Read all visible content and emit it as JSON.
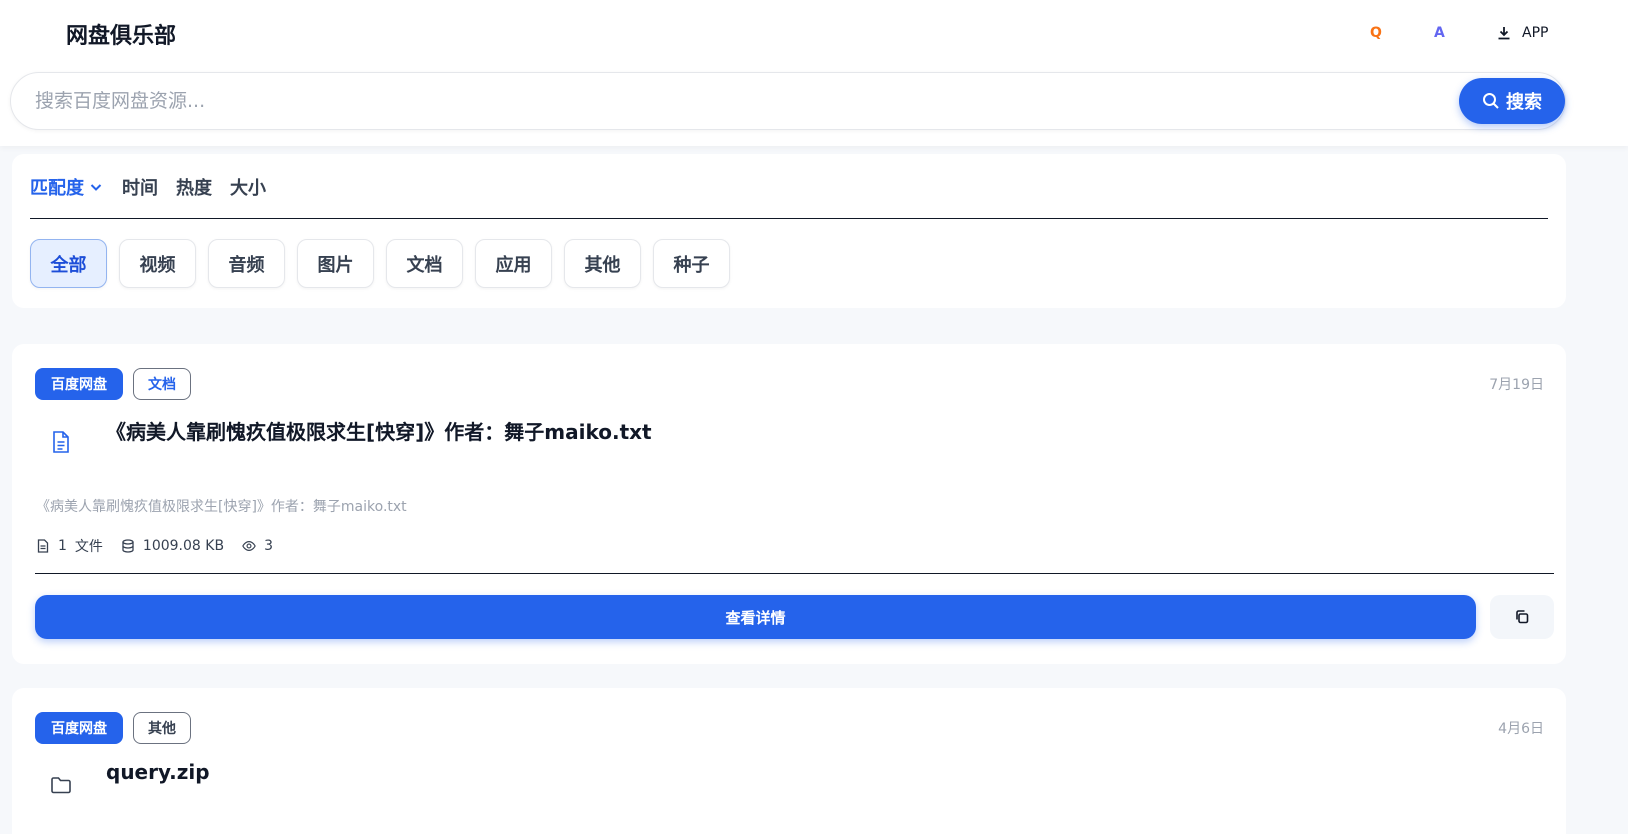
{
  "header": {
    "logo": "网盘俱乐部",
    "btn_q": "Q",
    "btn_a": "A",
    "btn_app": "APP"
  },
  "search": {
    "placeholder": "搜索百度网盘资源...",
    "button_label": "搜索"
  },
  "sort": {
    "items": [
      "匹配度",
      "时间",
      "热度",
      "大小"
    ],
    "active": "匹配度"
  },
  "categories": {
    "items": [
      "全部",
      "视频",
      "音频",
      "图片",
      "文档",
      "应用",
      "其他",
      "种子"
    ],
    "active": "全部"
  },
  "results": [
    {
      "source": "百度网盘",
      "type": "文档",
      "date": "7月19日",
      "icon": "document-icon",
      "title": "《病美人靠刷愧疚值极限求生[快穿]》作者：舞子maiko.txt",
      "description": "《病美人靠刷愧疚值极限求生[快穿]》作者：舞子maiko.txt",
      "file_count": "1",
      "file_unit": "文件",
      "size": "1009.08 KB",
      "views": "3",
      "detail_label": "查看详情"
    },
    {
      "source": "百度网盘",
      "type": "其他",
      "date": "4月6日",
      "icon": "folder-icon",
      "title": "query.zip"
    }
  ],
  "colors": {
    "primary": "#2563eb",
    "q_accent": "#f97316",
    "a_accent": "#6366f1"
  }
}
